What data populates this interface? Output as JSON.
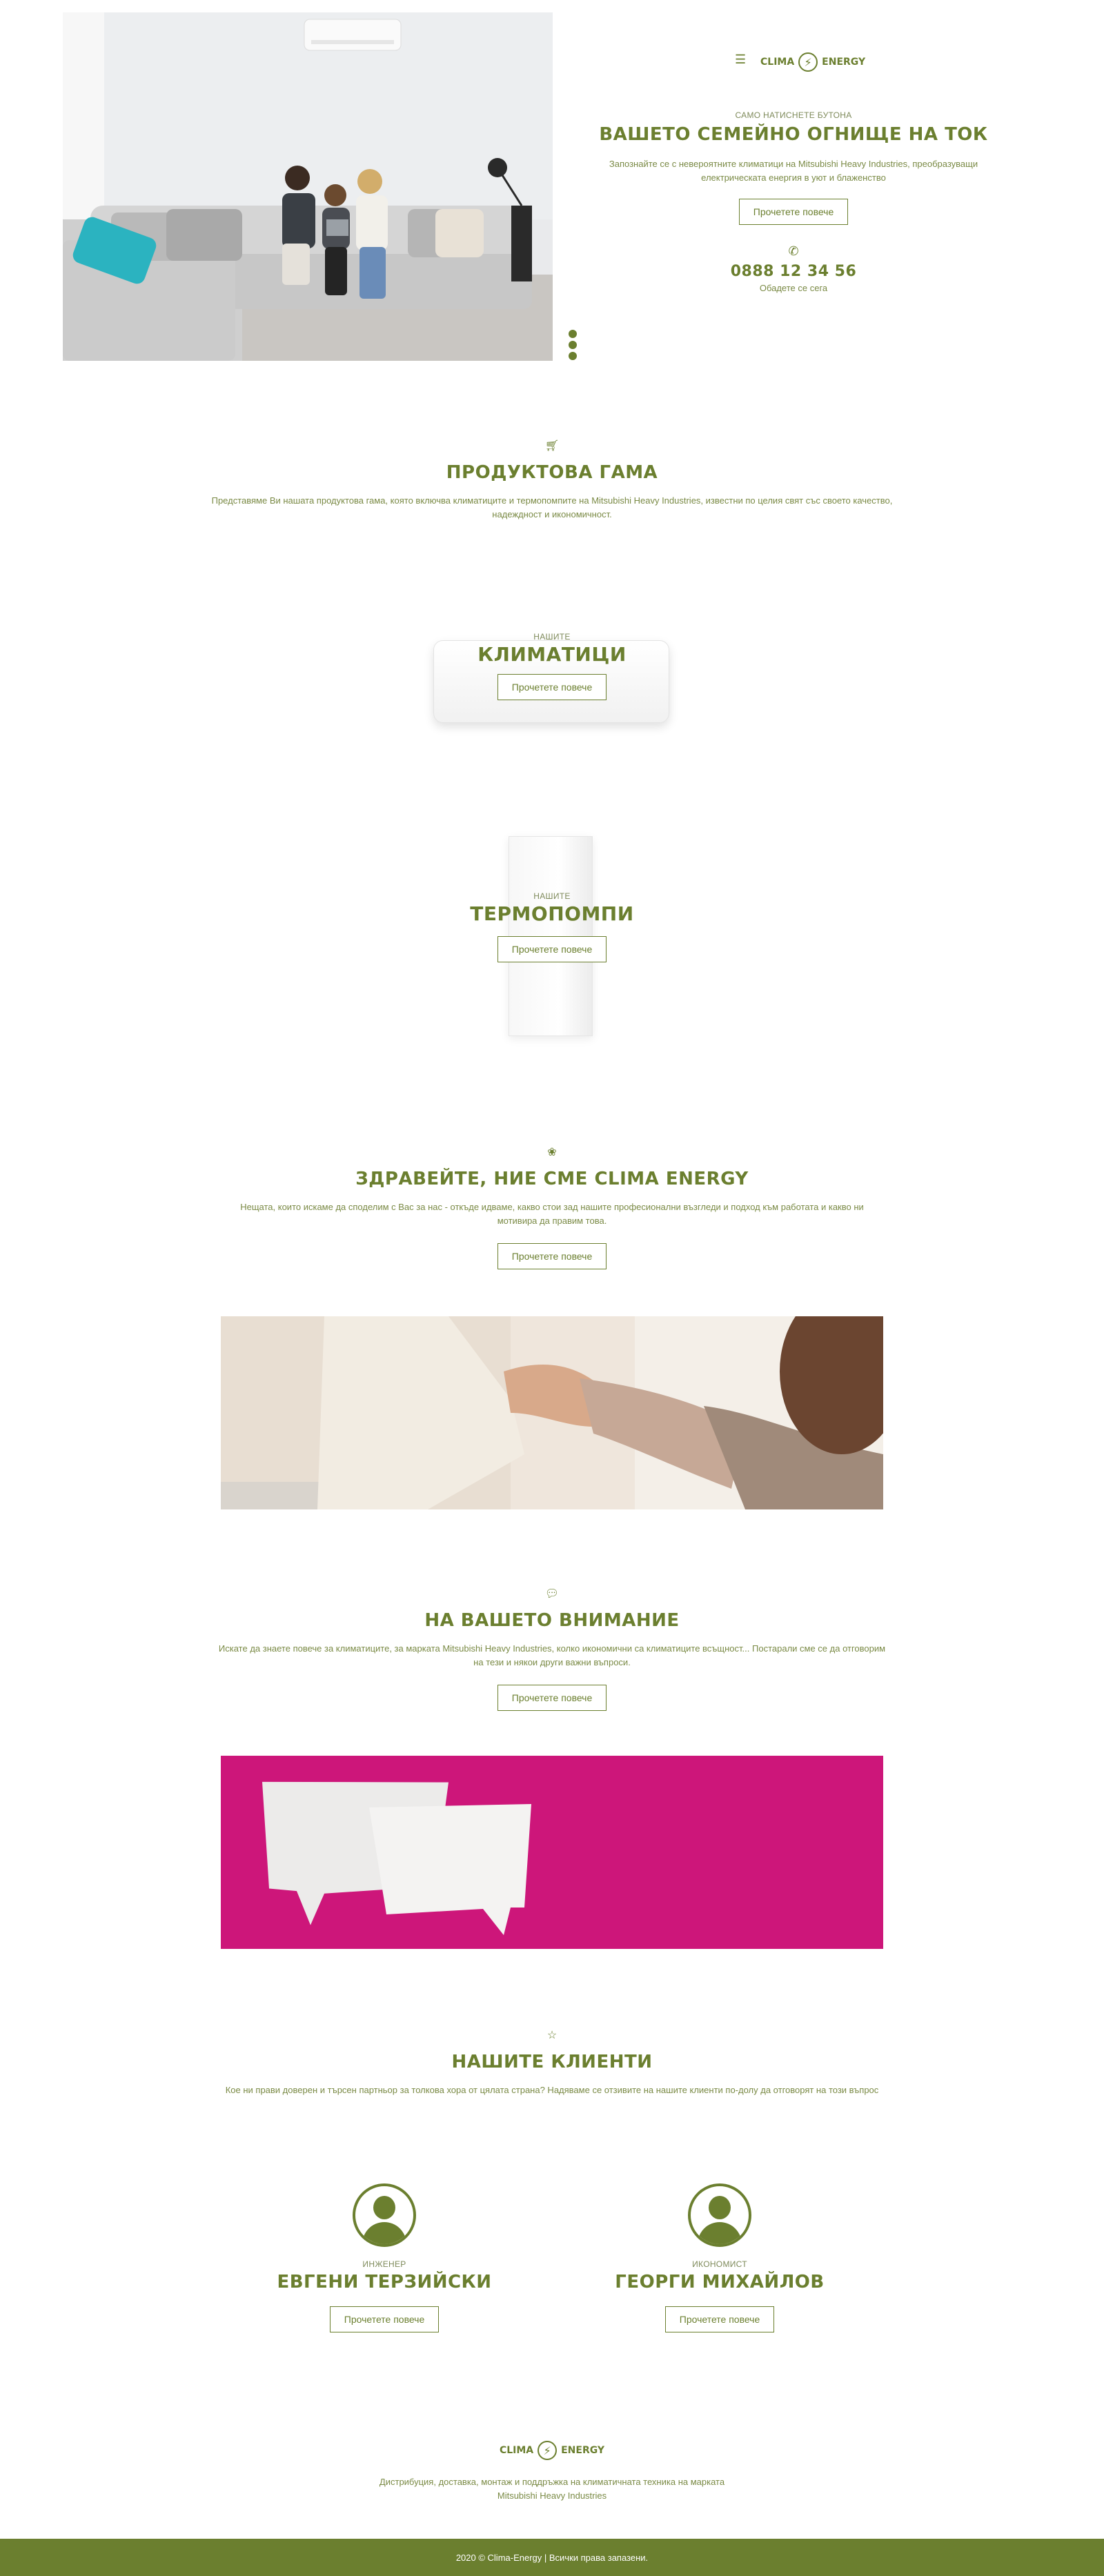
{
  "header": {
    "menu_icon": "hamburger-icon",
    "logo_left": "CLIMA",
    "logo_right": "ENERGY",
    "logo_icon": "lightning-bolt-icon"
  },
  "hero": {
    "kicker": "САМО НАТИСНЕТЕ БУТОНА",
    "title": "ВАШЕТО СЕМЕЙНО ОГНИЩЕ НА ТОК",
    "text": "Запознайте се с невероятните климатици на Mitsubishi Heavy Industries, преобразуващи електрическата енергия в уют и блаженство",
    "button": "Прочетете повече",
    "phone_icon": "phone-icon",
    "phone": "0888 12 34 56",
    "phone_sub": "Обадете се сега"
  },
  "products": {
    "icon": "cart-icon",
    "title": "ПРОДУКТОВА ГАМА",
    "text": "Представяме Ви нашата продуктова гама, която включва климатиците и термопомпите на Mitsubishi Heavy Industries, известни по целия свят със своето качество, надеждност и икономичност."
  },
  "ac": {
    "kicker": "НАШИТЕ",
    "title": "КЛИМАТИЦИ",
    "button": "Прочетете повече"
  },
  "heatpumps": {
    "kicker": "НАШИТЕ",
    "title": "ТЕРМОПОМПИ",
    "button": "Прочетете повече"
  },
  "about": {
    "icon": "lotus-icon",
    "title": "ЗДРАВЕЙТЕ, НИЕ СМЕ CLIMA ENERGY",
    "text": "Нещата, които искаме да споделим с Вас за нас - откъде идваме, какво стои зад нашите професионални възгледи и подход към работата и какво ни мотивира да правим това.",
    "button": "Прочетете повече"
  },
  "attention": {
    "icon": "chat-bubbles-icon",
    "title": "НА ВАШЕТО ВНИМАНИЕ",
    "text": "Искате да знаете повече за климатиците, за марката Mitsubishi Heavy Industries, колко икономични са климатиците всъщност... Постарали сме се да отговорим на тези и някои други важни въпроси.",
    "button": "Прочетете повече"
  },
  "clients": {
    "icon": "star-icon",
    "title": "НАШИТЕ КЛИЕНТИ",
    "text": "Кое ни прави доверен и търсен партньор за толкова хора от цялата страна? Надяваме се отзивите на нашите клиенти по-долу да отговорят на този въпрос",
    "people": [
      {
        "role": "ИНЖЕНЕР",
        "name": "ЕВГЕНИ ТЕРЗИЙСКИ",
        "button": "Прочетете повече"
      },
      {
        "role": "ИКОНОМИСТ",
        "name": "ГЕОРГИ МИХАЙЛОВ",
        "button": "Прочетете повече"
      }
    ]
  },
  "bottom": {
    "logo_left": "CLIMA",
    "logo_right": "ENERGY",
    "text_line1": "Дистрибуция, доставка, монтаж и поддръжка на климатичната техника на марката",
    "text_line2": "Mitsubishi Heavy Industries"
  },
  "footer": {
    "copyright": "2020 © Clima-Energy | Всички права запазени."
  },
  "colors": {
    "accent": "#6b7f2f",
    "pink": "#d4187f"
  }
}
